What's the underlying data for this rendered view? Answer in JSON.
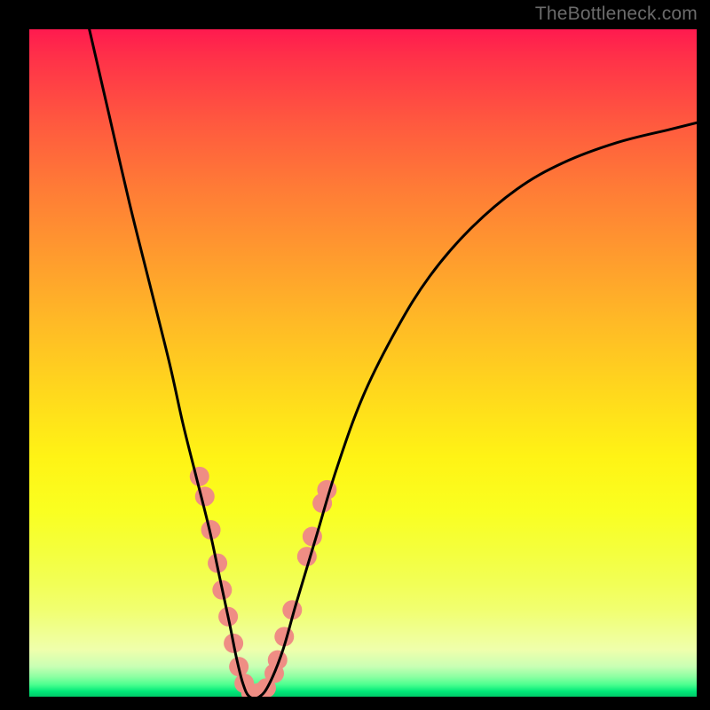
{
  "watermark": "TheBottleneck.com",
  "chart_data": {
    "type": "line",
    "title": "",
    "xlabel": "",
    "ylabel": "",
    "xlim": [
      0,
      100
    ],
    "ylim": [
      0,
      100
    ],
    "grid": false,
    "series": [
      {
        "name": "bottleneck-curve",
        "color": "#000000",
        "x": [
          9,
          12,
          15,
          18,
          21,
          23,
          25,
          27,
          28.5,
          30,
          31,
          32,
          33,
          34.5,
          36,
          38,
          40,
          43,
          46,
          50,
          55,
          60,
          66,
          73,
          80,
          88,
          96,
          100
        ],
        "y": [
          100,
          87,
          74,
          62,
          50,
          41,
          33,
          25,
          18,
          11,
          6,
          2,
          0,
          0,
          2,
          7,
          14,
          24,
          34,
          45,
          55,
          63,
          70,
          76,
          80,
          83,
          85,
          86
        ]
      }
    ],
    "markers": [
      {
        "name": "salmon-dots",
        "color": "#ef8d84",
        "radius": 11,
        "points": [
          {
            "x": 25.5,
            "y": 33
          },
          {
            "x": 26.3,
            "y": 30
          },
          {
            "x": 27.2,
            "y": 25
          },
          {
            "x": 28.2,
            "y": 20
          },
          {
            "x": 28.9,
            "y": 16
          },
          {
            "x": 29.8,
            "y": 12
          },
          {
            "x": 30.6,
            "y": 8
          },
          {
            "x": 31.4,
            "y": 4.5
          },
          {
            "x": 32.2,
            "y": 2
          },
          {
            "x": 33.2,
            "y": 0.6
          },
          {
            "x": 34.4,
            "y": 0.6
          },
          {
            "x": 35.5,
            "y": 1.3
          },
          {
            "x": 36.7,
            "y": 3.5
          },
          {
            "x": 37.2,
            "y": 5.5
          },
          {
            "x": 38.2,
            "y": 9
          },
          {
            "x": 39.4,
            "y": 13
          },
          {
            "x": 41.6,
            "y": 21
          },
          {
            "x": 42.4,
            "y": 24
          },
          {
            "x": 43.9,
            "y": 29
          },
          {
            "x": 44.6,
            "y": 31
          }
        ]
      }
    ]
  }
}
